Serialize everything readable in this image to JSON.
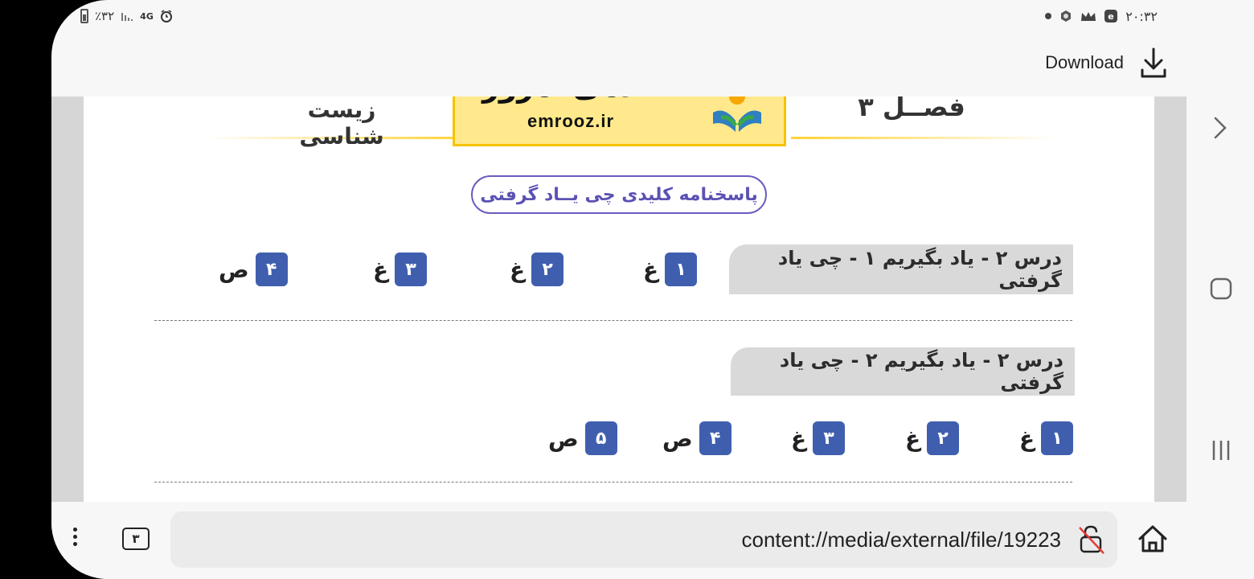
{
  "status": {
    "battery": "٪۳۲",
    "network": "4G",
    "time": "۲۰:۳۲"
  },
  "download_label": "Download",
  "doc": {
    "subject": "زیست شناسی",
    "chapter": "فصــل ۳",
    "logo_text": "آکادمی امروز",
    "logo_url": "emrooz.ir",
    "answer_key_title": "پاسخنامه کلیدی چی یــاد گرفتی",
    "section1": {
      "title": "درس ۲ - یاد بگیریم ۱ - چی یاد گرفتی",
      "answers": [
        {
          "num": "۱",
          "val": "غ"
        },
        {
          "num": "۲",
          "val": "غ"
        },
        {
          "num": "۳",
          "val": "غ"
        },
        {
          "num": "۴",
          "val": "ص"
        }
      ]
    },
    "section2": {
      "title": "درس ۲ - یاد بگیریم ۲ - چی یاد گرفتی",
      "answers": [
        {
          "num": "۱",
          "val": "غ"
        },
        {
          "num": "۲",
          "val": "غ"
        },
        {
          "num": "۳",
          "val": "غ"
        },
        {
          "num": "۴",
          "val": "ص"
        },
        {
          "num": "۵",
          "val": "ص"
        }
      ]
    }
  },
  "browser": {
    "tab_count": "۳",
    "url": "content://media/external/file/19223"
  },
  "colors": {
    "badge": "#3f5fae",
    "pill_border": "#6a5cbf",
    "logo_bg": "#ffe98c",
    "logo_border": "#f6c400"
  }
}
